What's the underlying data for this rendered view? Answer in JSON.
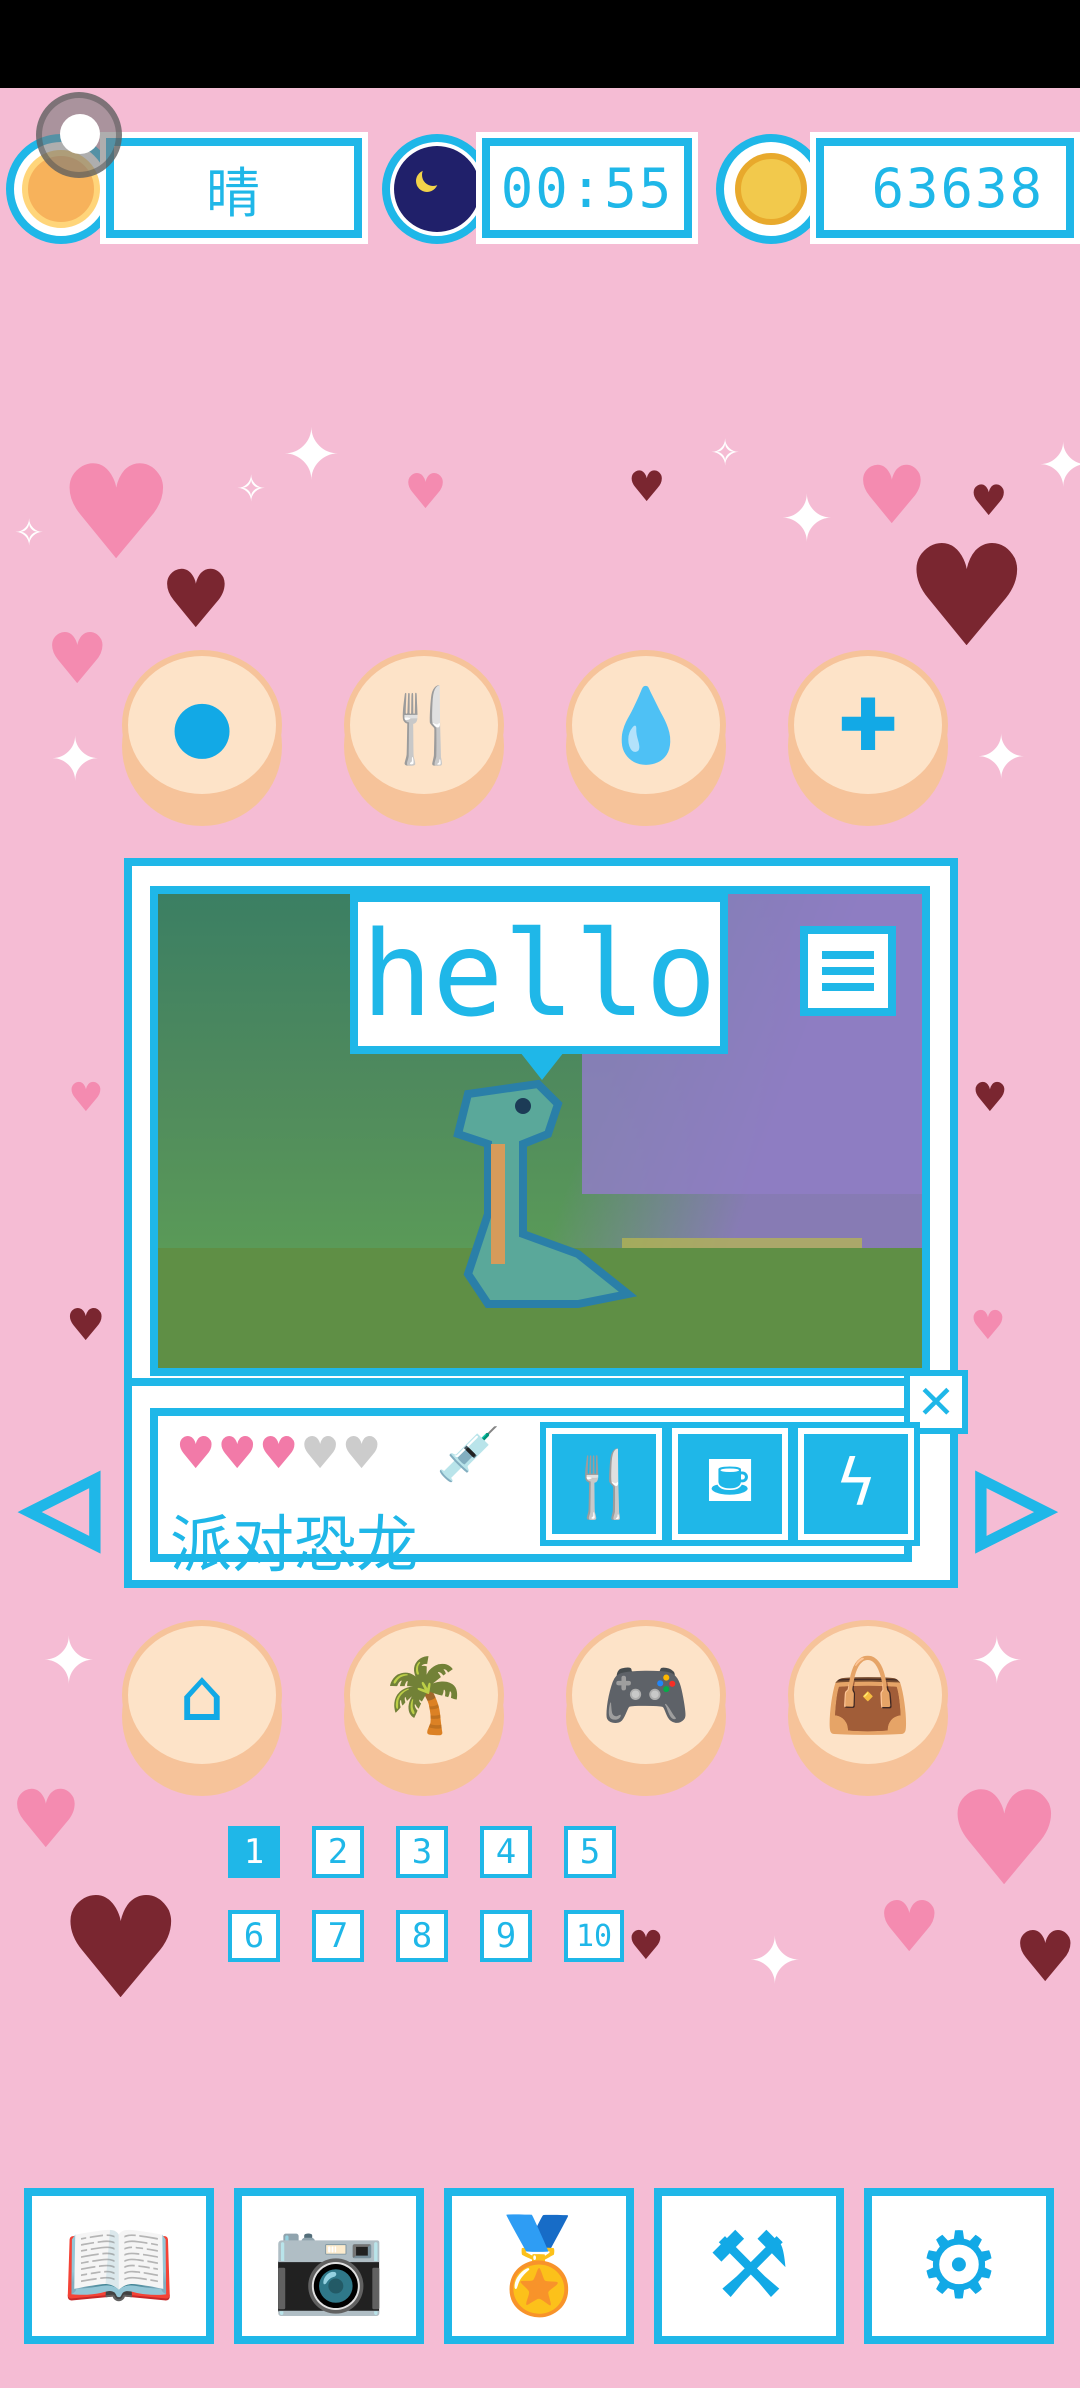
{
  "status_bar": {},
  "top": {
    "weather": {
      "label": "晴",
      "icon": "sun-face-icon"
    },
    "clock": {
      "time": "00:55",
      "icon": "moon-icon"
    },
    "coins": {
      "amount": "63638",
      "icon": "coin-icon"
    }
  },
  "care_buttons": [
    {
      "name": "pet-button",
      "icon": "slime-icon",
      "glyph": "●"
    },
    {
      "name": "feed-button",
      "icon": "fork-knife-icon",
      "glyph": "🍴"
    },
    {
      "name": "water-button",
      "icon": "water-drop-icon",
      "glyph": "💧"
    },
    {
      "name": "heal-button",
      "icon": "plus-icon",
      "glyph": "✚"
    }
  ],
  "scene": {
    "speech": "hello",
    "menu_icon": "hamburger-menu-icon"
  },
  "pet": {
    "name": "派对恐龙",
    "hearts_full": 3,
    "hearts_total": 5,
    "health_icon": "syringe-icon",
    "actions": [
      {
        "name": "stat-food",
        "icon": "fork-knife-icon",
        "glyph": "🍴"
      },
      {
        "name": "stat-water",
        "icon": "water-cup-icon",
        "glyph": "⛾"
      },
      {
        "name": "stat-energy",
        "icon": "lightning-icon",
        "glyph": "ϟ"
      }
    ],
    "close_glyph": "✕",
    "prev_glyph": "◁",
    "next_glyph": "▷"
  },
  "activity_buttons": [
    {
      "name": "home-button",
      "icon": "house-icon",
      "glyph": "⌂"
    },
    {
      "name": "beach-button",
      "icon": "beach-palm-icon",
      "glyph": "🌴"
    },
    {
      "name": "game-button",
      "icon": "gamepad-icon",
      "glyph": "🎮"
    },
    {
      "name": "shop-button",
      "icon": "bag-icon",
      "glyph": "👜"
    }
  ],
  "pages": {
    "current": "1",
    "numbers": [
      "1",
      "2",
      "3",
      "4",
      "5",
      "6",
      "7",
      "8",
      "9",
      "10"
    ]
  },
  "bottom_nav": [
    {
      "name": "book-button",
      "icon": "book-icon",
      "glyph": "📖"
    },
    {
      "name": "camera-button",
      "icon": "camera-icon",
      "glyph": "📷"
    },
    {
      "name": "medal-button",
      "icon": "medal-icon",
      "glyph": "🏅"
    },
    {
      "name": "tools-button",
      "icon": "tools-icon",
      "glyph": "⚒"
    },
    {
      "name": "settings-button",
      "icon": "gear-icon",
      "glyph": "⚙"
    }
  ],
  "colors": {
    "background": "#f5bcd4",
    "accent": "#1fb7e8",
    "heart_full": "#f27aa8",
    "heart_empty": "#cccccc",
    "button_face": "#fde3c8"
  }
}
